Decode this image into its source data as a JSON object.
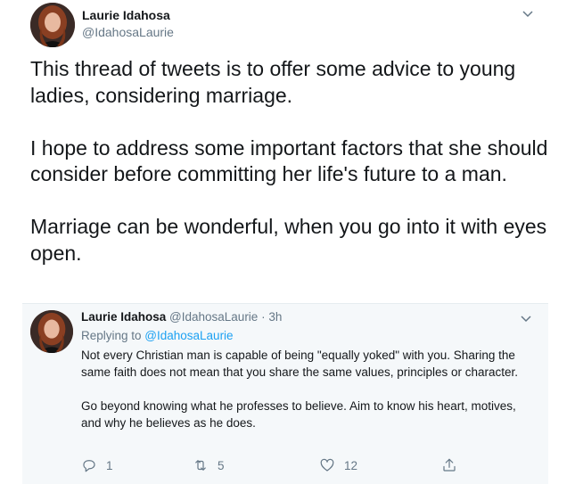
{
  "main_tweet": {
    "author_name": "Laurie Idahosa",
    "author_handle": "@IdahosaLaurie",
    "paragraphs": [
      "This thread of tweets is to offer some advice to young ladies,  considering marriage.",
      "I hope to address some important factors that she should consider before committing her life's future to a man.",
      "Marriage can be wonderful,  when you go into it with eyes open."
    ]
  },
  "reply_tweet": {
    "author_name": "Laurie Idahosa",
    "author_handle": "@IdahosaLaurie",
    "separator": " · ",
    "time": "3h",
    "replying_label": "Replying to ",
    "replying_to": "@IdahosaLaurie",
    "paragraphs": [
      "Not every Christian man is capable of being \"equally yoked\" with you. Sharing the same faith does not mean that you share the same values, principles or character.",
      "Go beyond knowing what he professes to believe. Aim to know his heart, motives, and why he believes as he does."
    ],
    "actions": {
      "replies": "1",
      "retweets": "5",
      "likes": "12"
    }
  },
  "icons": {
    "more": "chevron-down-icon",
    "reply": "reply-icon",
    "retweet": "retweet-icon",
    "like": "heart-icon",
    "share": "share-icon"
  },
  "colors": {
    "text": "#14171a",
    "secondary": "#657786",
    "link": "#1da1f2",
    "card_bg": "#f5f8fa"
  }
}
